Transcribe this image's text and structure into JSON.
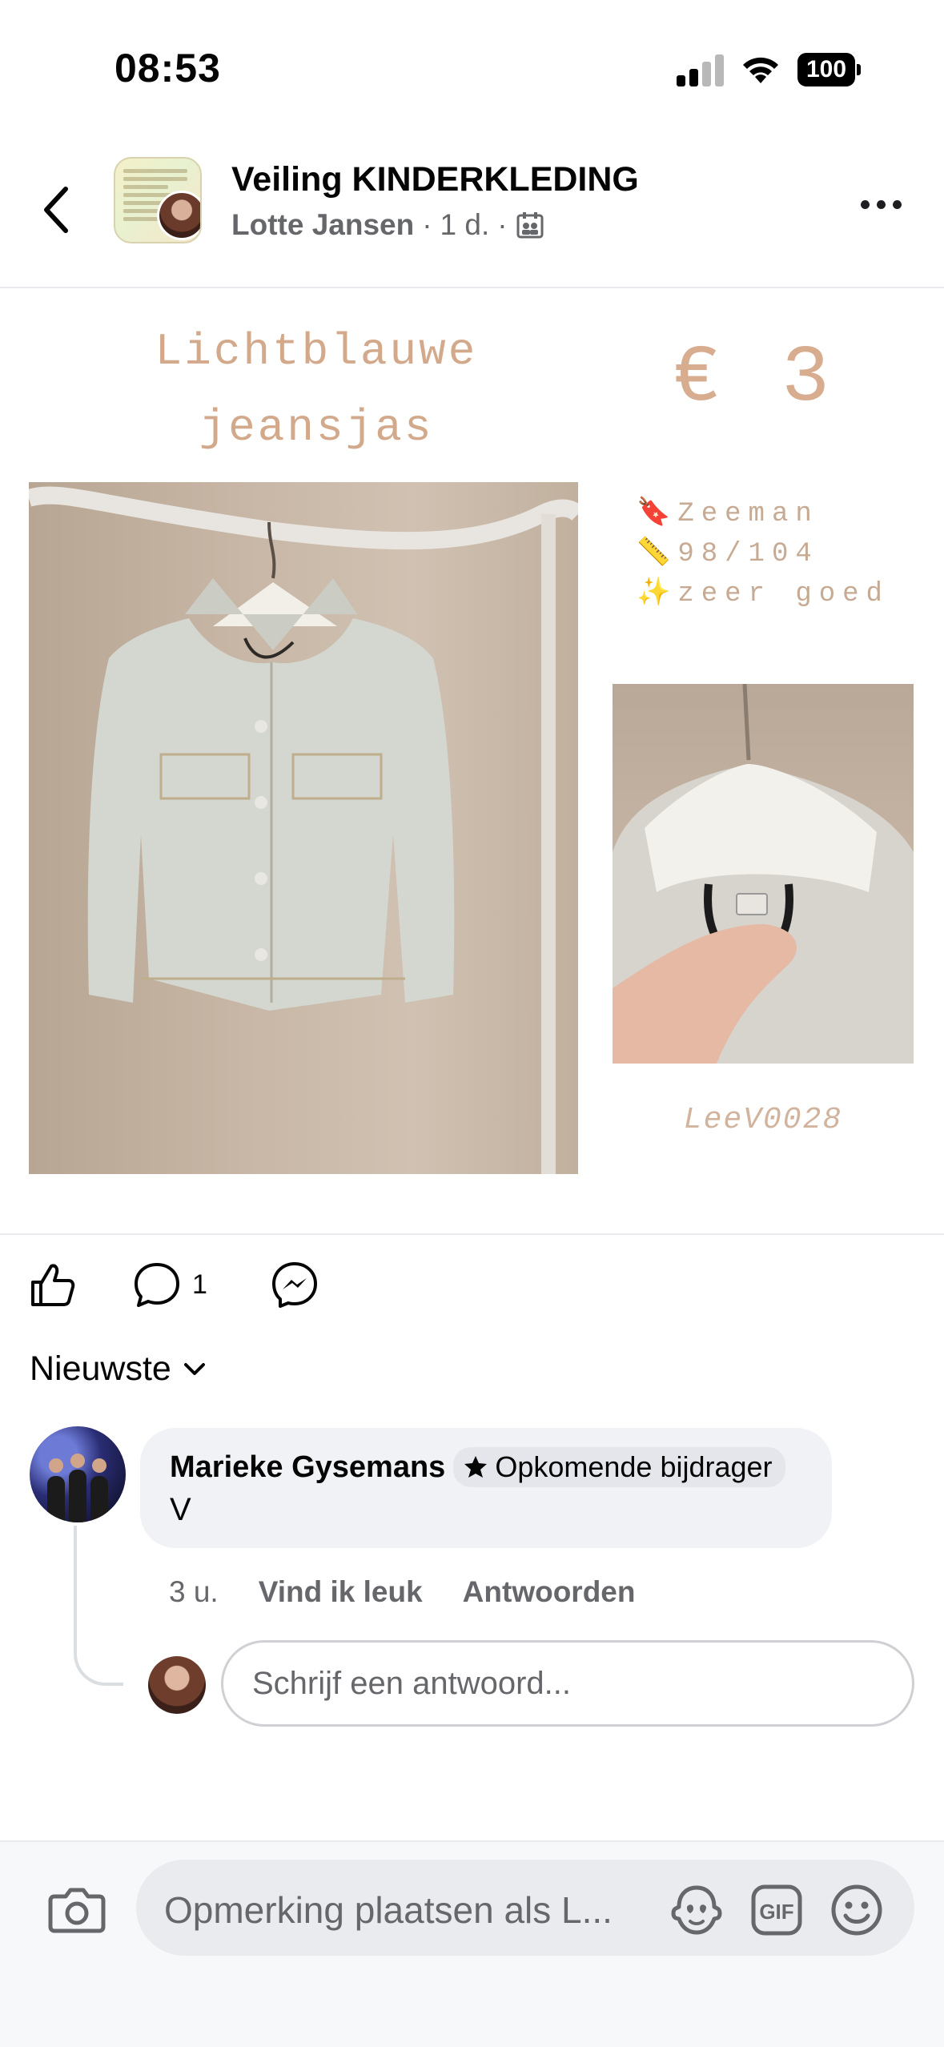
{
  "status_bar": {
    "time": "08:53",
    "battery": "100"
  },
  "header": {
    "group_name": "Veiling KINDERKLEDING",
    "author": "Lotte Jansen",
    "time_ago": "1 d.",
    "separator": "·"
  },
  "post": {
    "title_line1": "Lichtblauwe",
    "title_line2": "jeansjas",
    "price": "€ 3",
    "brand": "🔖Zeeman",
    "size": "📏98/104",
    "condition": "✨zeer goed",
    "code": "LeeV0028"
  },
  "actions": {
    "comment_count": "1"
  },
  "comments": {
    "sort_label": "Nieuwste",
    "items": [
      {
        "name": "Marieke Gysemans",
        "badge": "Opkomende bijdrager",
        "text": "V",
        "time": "3 u.",
        "like": "Vind ik leuk",
        "reply": "Antwoorden"
      }
    ],
    "reply_placeholder": "Schrijf een antwoord..."
  },
  "composer": {
    "placeholder": "Opmerking plaatsen als L..."
  },
  "icons": [
    "back-icon",
    "more-icon",
    "like-icon",
    "comment-icon",
    "messenger-icon",
    "chevron-down-icon",
    "star-icon",
    "camera-icon",
    "avatar-sticker-icon",
    "gif-icon",
    "emoji-icon",
    "group-icon"
  ],
  "colors": {
    "accent_title": "#d3a98b",
    "meta_gray": "#65676b",
    "bubble_bg": "#f0f2f5"
  }
}
